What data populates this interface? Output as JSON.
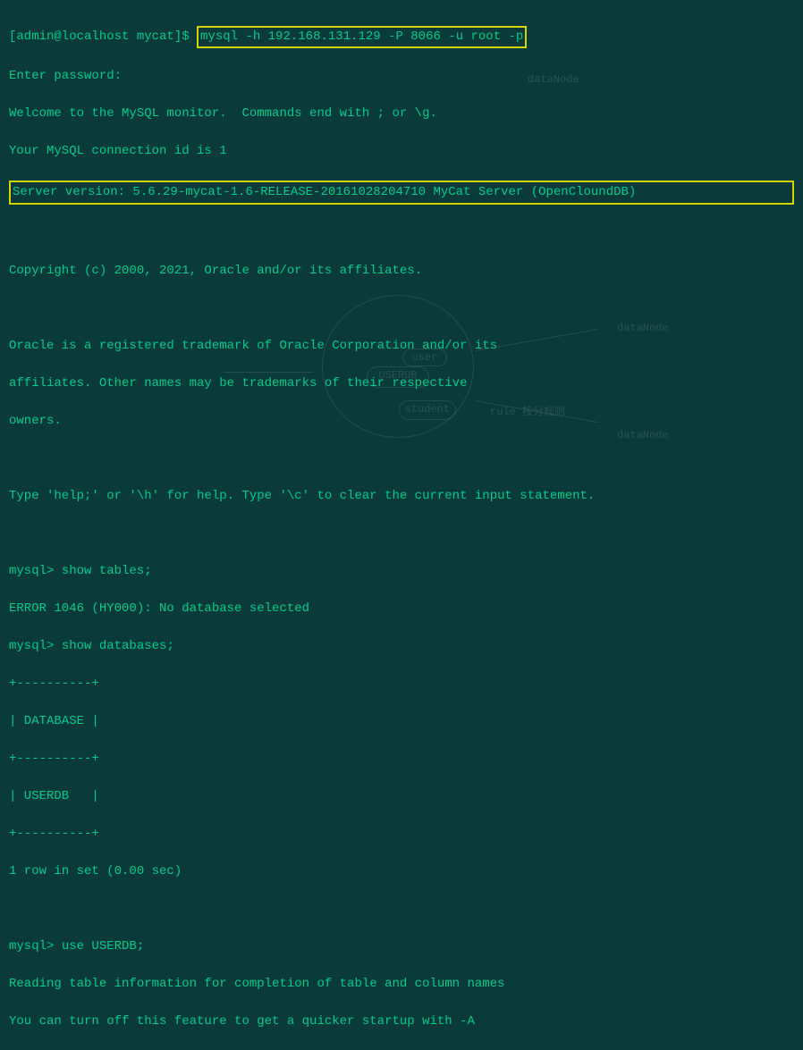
{
  "prompt_user": "[admin@localhost mycat]$",
  "command": "mysql -h 192.168.131.129 -P 8066 -u root -p",
  "lines": {
    "enter_pw": "Enter password:",
    "welcome": "Welcome to the MySQL monitor.  Commands end with ; or \\g.",
    "conn_id": "Your MySQL connection id is 1",
    "server_version": "Server version: 5.6.29-mycat-1.6-RELEASE-20161028204710 MyCat Server (OpenCloundDB)",
    "copyright": "Copyright (c) 2000, 2021, Oracle and/or its affiliates.",
    "trademark1": "Oracle is a registered trademark of Oracle Corporation and/or its",
    "trademark2": "affiliates. Other names may be trademarks of their respective",
    "trademark3": "owners.",
    "help": "Type 'help;' or '\\h' for help. Type '\\c' to clear the current input statement."
  },
  "mysql_prompt": "mysql>",
  "cmd_show_tables": " show tables;",
  "err_1046": "ERROR 1046 (HY000): No database selected",
  "cmd_show_db": " show databases;",
  "table": {
    "sep": "+----------+",
    "header": "| DATABASE |",
    "row1": "| USERDB   |"
  },
  "rowset": "1 row in set (0.00 sec)",
  "cmd_use": " use USERDB;",
  "reading1": "Reading table information for completion of table and column names",
  "reading2": "You can turn off this feature to get a quicker startup with -A",
  "watermark": {
    "userdb": "USERDB",
    "user": "user",
    "student": "student",
    "datanode1": "dataNode",
    "datanode2": "dataNode",
    "datanode3": "dataNode",
    "rule": "rule 按分规则"
  }
}
